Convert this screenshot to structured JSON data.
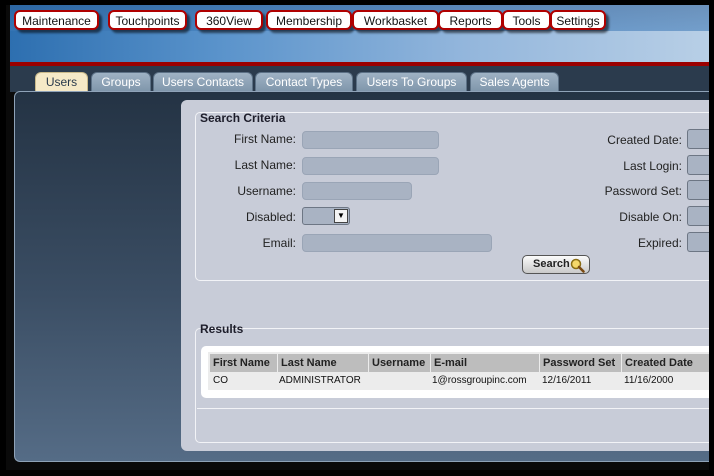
{
  "top_menu": [
    "Maintenance",
    "Touchpoints",
    "360View",
    "Membership",
    "Workbasket",
    "Reports",
    "Tools",
    "Settings"
  ],
  "tabs": [
    "Users",
    "Groups",
    "Users Contacts",
    "Contact Types",
    "Users To Groups",
    "Sales Agents"
  ],
  "active_tab": "Users",
  "search": {
    "title": "Search Criteria",
    "first_name_label": "First Name:",
    "last_name_label": "Last Name:",
    "username_label": "Username:",
    "disabled_label": "Disabled:",
    "email_label": "Email:",
    "created_date_label": "Created Date:",
    "last_login_label": "Last Login:",
    "password_set_label": "Password Set:",
    "disable_on_label": "Disable On:",
    "expired_label": "Expired:",
    "search_button": "Search"
  },
  "results": {
    "title": "Results",
    "columns": [
      "First Name",
      "Last Name",
      "Username",
      "E-mail",
      "Password Set",
      "Created Date"
    ],
    "rows": [
      [
        "CO",
        "ADMINISTRATOR",
        "",
        "1@rossgroupinc.com",
        "12/16/2011",
        "11/16/2000"
      ]
    ]
  },
  "colors": {
    "menu_border": "#b00000",
    "accent_red": "#9b0000",
    "active_tab": "#f5e9c7"
  }
}
